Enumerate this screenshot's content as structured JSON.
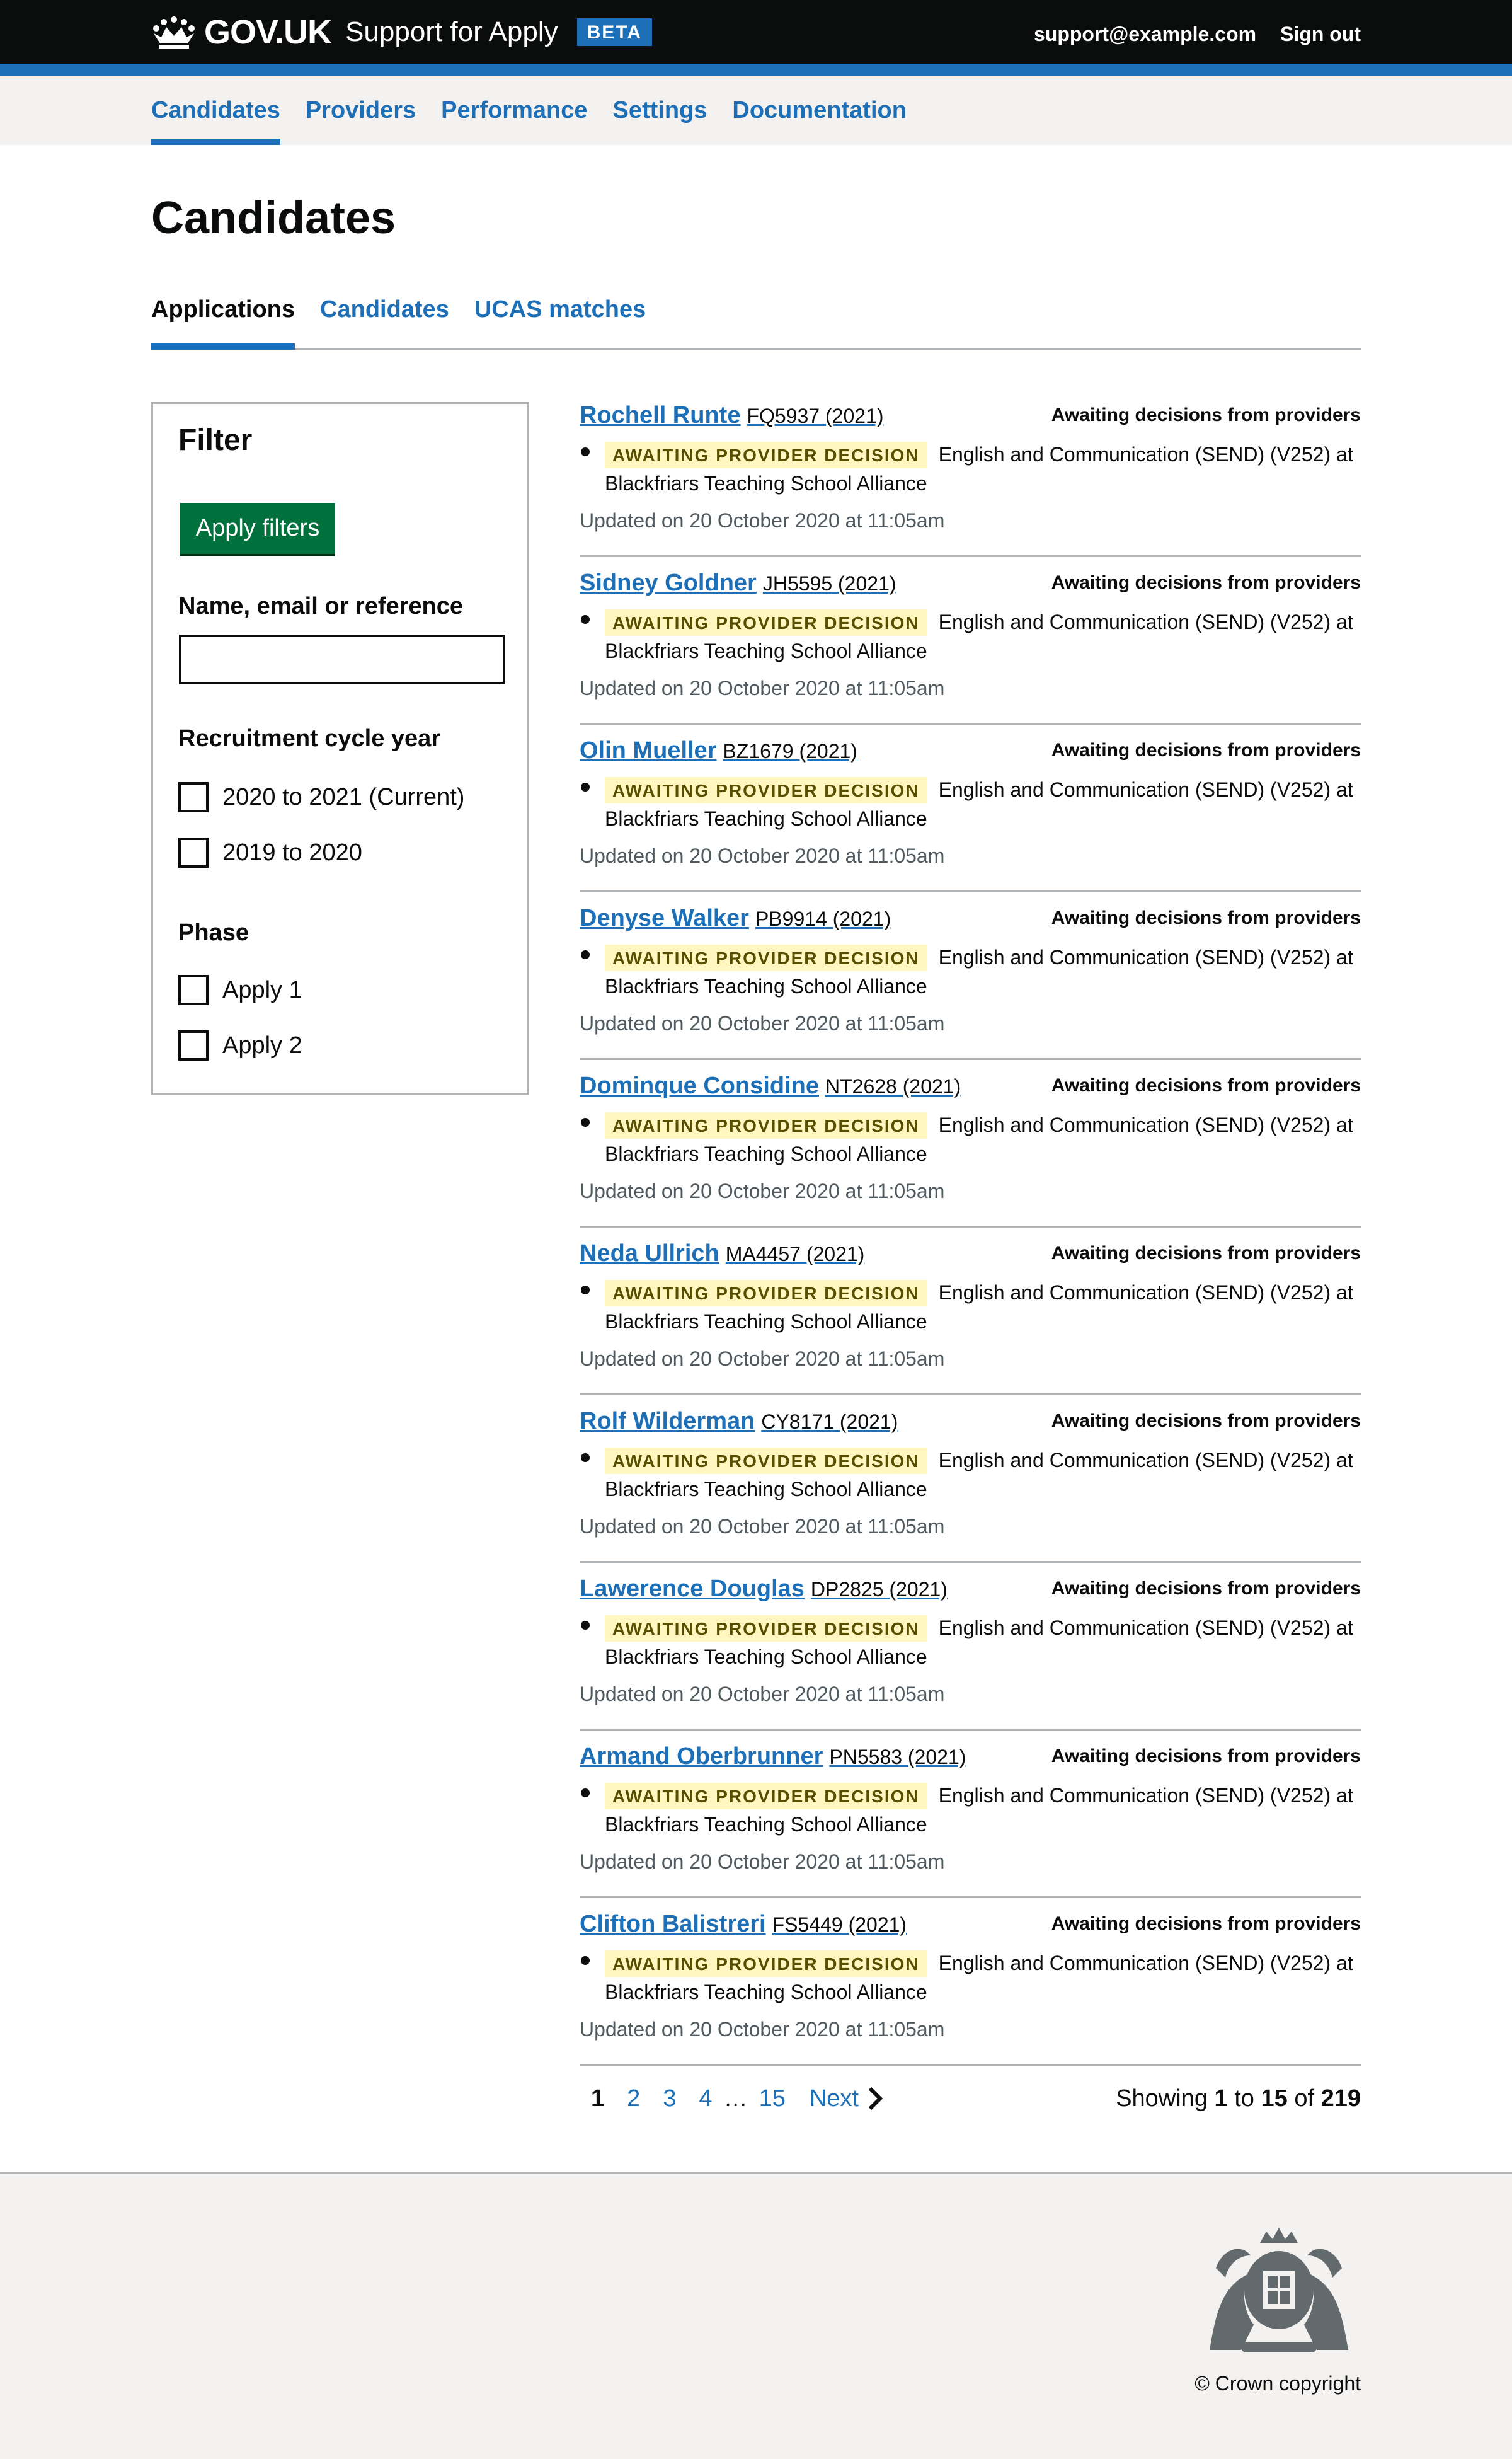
{
  "header": {
    "logo_text": "GOV.UK",
    "service_name": "Support for Apply",
    "phase_tag": "BETA",
    "user_email": "support@example.com",
    "sign_out": "Sign out"
  },
  "primary_nav": {
    "items": [
      {
        "label": "Candidates",
        "active": true
      },
      {
        "label": "Providers"
      },
      {
        "label": "Performance"
      },
      {
        "label": "Settings"
      },
      {
        "label": "Documentation"
      }
    ]
  },
  "page_title": "Candidates",
  "sub_nav": {
    "items": [
      {
        "label": "Applications",
        "active": true
      },
      {
        "label": "Candidates"
      },
      {
        "label": "UCAS matches"
      }
    ]
  },
  "filter": {
    "heading": "Filter",
    "apply_button": "Apply filters",
    "search_label": "Name, email or reference",
    "search_value": "",
    "cycle_label": "Recruitment cycle year",
    "cycle_options": [
      "2020 to 2021 (Current)",
      "2019 to 2020"
    ],
    "phase_label": "Phase",
    "phase_options": [
      "Apply 1",
      "Apply 2"
    ]
  },
  "applications": [
    {
      "name": "Rochell Runte",
      "ref": "FQ5937 (2021)",
      "status": "Awaiting decisions from providers",
      "tag": "AWAITING PROVIDER DECISION",
      "course": "English and Communication (SEND) (V252) at",
      "provider": "Blackfriars Teaching School Alliance",
      "updated": "Updated on 20 October 2020 at 11:05am"
    },
    {
      "name": "Sidney Goldner",
      "ref": "JH5595 (2021)",
      "status": "Awaiting decisions from providers",
      "tag": "AWAITING PROVIDER DECISION",
      "course": "English and Communication (SEND) (V252) at",
      "provider": "Blackfriars Teaching School Alliance",
      "updated": "Updated on 20 October 2020 at 11:05am"
    },
    {
      "name": "Olin Mueller",
      "ref": "BZ1679 (2021)",
      "status": "Awaiting decisions from providers",
      "tag": "AWAITING PROVIDER DECISION",
      "course": "English and Communication (SEND) (V252) at",
      "provider": "Blackfriars Teaching School Alliance",
      "updated": "Updated on 20 October 2020 at 11:05am"
    },
    {
      "name": "Denyse Walker",
      "ref": "PB9914 (2021)",
      "status": "Awaiting decisions from providers",
      "tag": "AWAITING PROVIDER DECISION",
      "course": "English and Communication (SEND) (V252) at",
      "provider": "Blackfriars Teaching School Alliance",
      "updated": "Updated on 20 October 2020 at 11:05am"
    },
    {
      "name": "Dominque Considine",
      "ref": "NT2628 (2021)",
      "status": "Awaiting decisions from providers",
      "tag": "AWAITING PROVIDER DECISION",
      "course": "English and Communication (SEND) (V252) at",
      "provider": "Blackfriars Teaching School Alliance",
      "updated": "Updated on 20 October 2020 at 11:05am"
    },
    {
      "name": "Neda Ullrich",
      "ref": "MA4457 (2021)",
      "status": "Awaiting decisions from providers",
      "tag": "AWAITING PROVIDER DECISION",
      "course": "English and Communication (SEND) (V252) at",
      "provider": "Blackfriars Teaching School Alliance",
      "updated": "Updated on 20 October 2020 at 11:05am"
    },
    {
      "name": "Rolf Wilderman",
      "ref": "CY8171 (2021)",
      "status": "Awaiting decisions from providers",
      "tag": "AWAITING PROVIDER DECISION",
      "course": "English and Communication (SEND) (V252) at",
      "provider": "Blackfriars Teaching School Alliance",
      "updated": "Updated on 20 October 2020 at 11:05am"
    },
    {
      "name": "Lawerence Douglas",
      "ref": "DP2825 (2021)",
      "status": "Awaiting decisions from providers",
      "tag": "AWAITING PROVIDER DECISION",
      "course": "English and Communication (SEND) (V252) at",
      "provider": "Blackfriars Teaching School Alliance",
      "updated": "Updated on 20 October 2020 at 11:05am"
    },
    {
      "name": "Armand Oberbrunner",
      "ref": "PN5583 (2021)",
      "status": "Awaiting decisions from providers",
      "tag": "AWAITING PROVIDER DECISION",
      "course": "English and Communication (SEND) (V252) at",
      "provider": "Blackfriars Teaching School Alliance",
      "updated": "Updated on 20 October 2020 at 11:05am"
    },
    {
      "name": "Clifton Balistreri",
      "ref": "FS5449 (2021)",
      "status": "Awaiting decisions from providers",
      "tag": "AWAITING PROVIDER DECISION",
      "course": "English and Communication (SEND) (V252) at",
      "provider": "Blackfriars Teaching School Alliance",
      "updated": "Updated on 20 October 2020 at 11:05am"
    }
  ],
  "pagination": {
    "pages": [
      "1",
      "2",
      "3",
      "4"
    ],
    "current": "1",
    "ellipsis": "…",
    "last_page": "15",
    "next": "Next",
    "showing_prefix": "Showing",
    "from": "1",
    "to_word": "to",
    "to": "15",
    "of_word": "of",
    "total": "219"
  },
  "footer": {
    "copyright": "© Crown copyright"
  },
  "colors": {
    "header_bg": "#0b0c0c",
    "brand_blue": "#1d70b8",
    "button_green": "#00703c",
    "tag_bg": "#fff7bf",
    "tag_text": "#594d00"
  }
}
